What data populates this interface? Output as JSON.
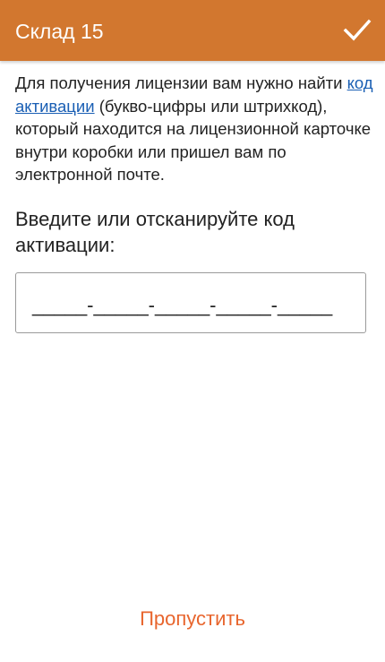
{
  "appbar": {
    "title": "Склад 15",
    "confirm_icon": "checkmark-icon",
    "background_color": "#d2772f",
    "text_color": "#ffffff"
  },
  "info": {
    "text_before": "Для получения лицензии вам нужно найти ",
    "link_label": "код активации",
    "text_after": " (букво-цифры или штрихкод), который находится на лицензионной карточке внутри коробки или пришел вам по электронной почте.",
    "link_color": "#1a5fb4"
  },
  "prompt": {
    "label": "Введите или отсканируйте код активации:"
  },
  "code_input": {
    "value": "_____-_____-_____-_____-_____"
  },
  "footer": {
    "skip_label": "Пропустить",
    "accent_color": "#e8652d"
  }
}
